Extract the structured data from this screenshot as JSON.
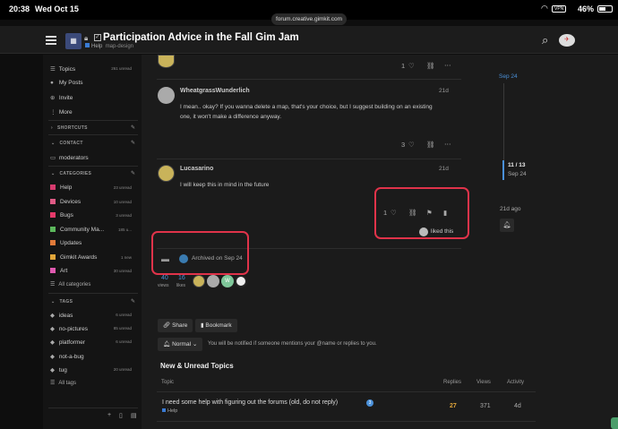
{
  "status_bar": {
    "time": "20:38",
    "date": "Wed Oct 15",
    "url": "forum.creative.gimkit.com",
    "battery": "46%",
    "vpn": "VPN"
  },
  "header": {
    "title": "Participation Advice in the Fall Gim Jam",
    "category": "Help",
    "tag": "map-design"
  },
  "sidebar": {
    "nav": [
      {
        "label": "Topics",
        "count": "261 unread"
      },
      {
        "label": "My Posts"
      },
      {
        "label": "Invite"
      },
      {
        "label": "More"
      }
    ],
    "shortcuts_label": "SHORTCUTS",
    "contact_label": "CONTACT",
    "contact_item": "moderators",
    "categories_label": "CATEGORIES",
    "categories": [
      {
        "label": "Help",
        "count": "23 unread",
        "color": "#d63b6e"
      },
      {
        "label": "Devices",
        "count": "10 unread",
        "color": "#e05a85"
      },
      {
        "label": "Bugs",
        "count": "3 unread",
        "color": "#e63a6a"
      },
      {
        "label": "Community Ma...",
        "count": "185 u...",
        "color": "#5cb85c"
      },
      {
        "label": "Updates",
        "count": "",
        "color": "#e07a3a"
      },
      {
        "label": "Gimkit Awards",
        "count": "1 new",
        "color": "#e0a53a"
      },
      {
        "label": "Art",
        "count": "30 unread",
        "color": "#e05ab0"
      }
    ],
    "all_categories": "All categories",
    "tags_label": "TAGS",
    "tags": [
      {
        "label": "ideas",
        "count": "6 unread"
      },
      {
        "label": "no-pictures",
        "count": "85 unread"
      },
      {
        "label": "platformer",
        "count": "6 unread"
      },
      {
        "label": "not-a-bug",
        "count": ""
      },
      {
        "label": "tug",
        "count": "20 unread"
      }
    ],
    "all_tags": "All tags"
  },
  "posts": [
    {
      "likes": "1"
    },
    {
      "author": "WheatgrassWunderlich",
      "date": "21d",
      "text1": "I mean.. okay? If you wanna delete a map, that's your choice, but I suggest building on an existing",
      "text2": "one, it won't make a difference anyway.",
      "likes": "3"
    },
    {
      "author": "Lucasarino",
      "date": "21d",
      "text": "I will keep this in mind in the future",
      "likes": "1",
      "liked_this": "liked this"
    }
  ],
  "archived": {
    "text": "Archived on Sep 24"
  },
  "stats": {
    "views_num": "40",
    "views_label": "views",
    "likes_num": "16",
    "likes_label": "likes"
  },
  "actions": {
    "share": "Share",
    "bookmark": "Bookmark",
    "notify": "Normal",
    "notify_desc": "You will be notified if someone mentions your @name or replies to you."
  },
  "new_unread": {
    "title": "New & Unread Topics",
    "headers": {
      "topic": "Topic",
      "replies": "Replies",
      "views": "Views",
      "activity": "Activity"
    },
    "rows": [
      {
        "title": "I need some help with figuring out the forums (old, do not reply)",
        "badge": "3",
        "category": "Help",
        "replies": "27",
        "views": "371",
        "activity": "4d"
      }
    ]
  },
  "timeline": {
    "top": "Sep 24",
    "position": "11 / 13",
    "position_date": "Sep 24",
    "bottom": "21d ago"
  }
}
